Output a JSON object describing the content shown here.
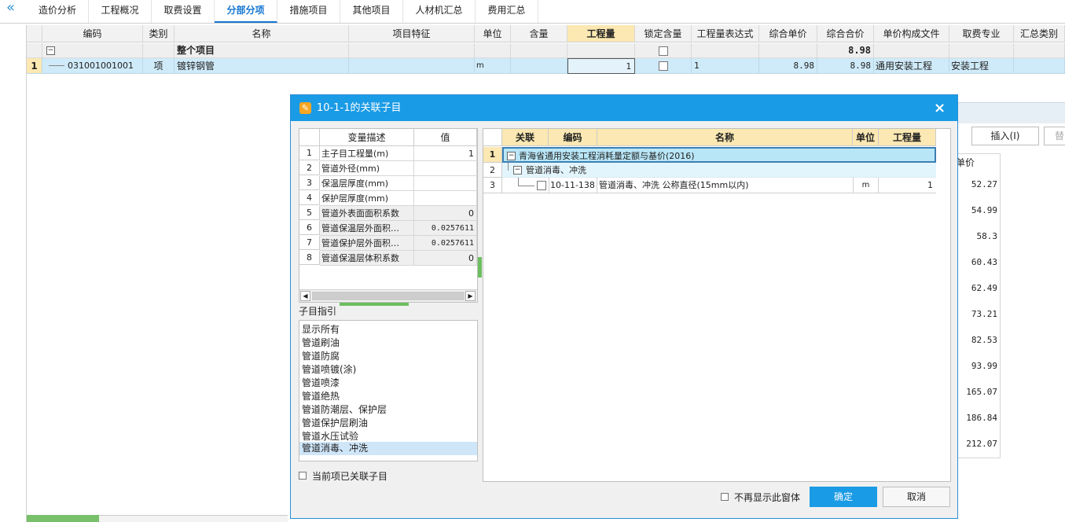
{
  "tabs": [
    "造价分析",
    "工程概况",
    "取费设置",
    "分部分项",
    "措施项目",
    "其他项目",
    "人材机汇总",
    "费用汇总"
  ],
  "active_tab": "分部分项",
  "grid": {
    "headers": [
      "编码",
      "类别",
      "名称",
      "项目特征",
      "单位",
      "含量",
      "工程量",
      "锁定含量",
      "工程量表达式",
      "综合单价",
      "综合合价",
      "单价构成文件",
      "取费专业",
      "汇总类别"
    ],
    "row1": {
      "name": "整个项目",
      "total": "8.98"
    },
    "row2": {
      "index": "1",
      "code": "031001001001",
      "type": "项",
      "name": "镀锌钢管",
      "unit": "m",
      "qty": "1",
      "expr": "1",
      "unit_price": "8.98",
      "total": "8.98",
      "file": "通用安装工程",
      "specialty": "安装工程"
    }
  },
  "background": {
    "insert_button": "插入(I)",
    "unit_price_header": "单价",
    "prices": [
      "52.27",
      "54.99",
      "58.3",
      "60.43",
      "62.49",
      "73.21",
      "82.53",
      "93.99",
      "165.07",
      "186.84",
      "212.07"
    ]
  },
  "dialog": {
    "title": "10-1-1的关联子目",
    "var_table": {
      "headers": [
        "变量描述",
        "值"
      ],
      "rows": [
        {
          "index": "1",
          "desc": "主子目工程量(m)",
          "value": "1"
        },
        {
          "index": "2",
          "desc": "管道外径(mm)",
          "value": ""
        },
        {
          "index": "3",
          "desc": "保温层厚度(mm)",
          "value": ""
        },
        {
          "index": "4",
          "desc": "保护层厚度(mm)",
          "value": ""
        },
        {
          "index": "5",
          "desc": "管道外表面面积系数",
          "value": "0"
        },
        {
          "index": "6",
          "desc": "管道保温层外面积…",
          "value": "0.0257611"
        },
        {
          "index": "7",
          "desc": "管道保护层外面积…",
          "value": "0.0257611"
        },
        {
          "index": "8",
          "desc": "管道保温层体积系数",
          "value": "0"
        }
      ]
    },
    "guide_label": "子目指引",
    "guide_items": [
      "显示所有",
      "管道刷油",
      "管道防腐",
      "管道喷镀(涂)",
      "管道喷漆",
      "管道绝热",
      "管道防潮层、保护层",
      "管道保护层刷油",
      "管道水压试验",
      "管道消毒、冲洗"
    ],
    "guide_selected": "管道消毒、冲洗",
    "current_linked_label": "当前项已关联子目",
    "tree": {
      "headers": [
        "关联",
        "编码",
        "名称",
        "单位",
        "工程量"
      ],
      "rows": [
        {
          "index": "1",
          "name": "青海省通用安装工程消耗量定额与基价(2016)"
        },
        {
          "index": "2",
          "name": "管道消毒、冲洗"
        },
        {
          "index": "3",
          "code": "10-11-138",
          "name": "管道消毒、冲洗 公称直径(15mm以内)",
          "unit": "m",
          "qty": "1"
        }
      ]
    },
    "no_show_label": "不再显示此窗体",
    "ok_label": "确定",
    "cancel_label": "取消",
    "accent": "#1a9be5"
  }
}
